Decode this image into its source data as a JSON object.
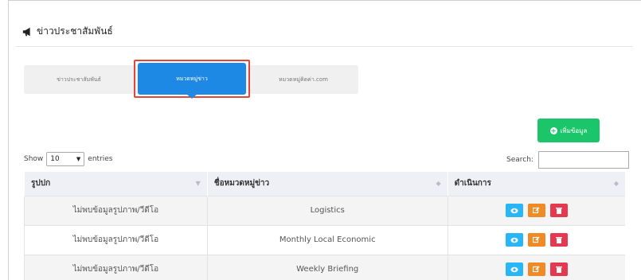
{
  "header": {
    "title": "ข่าวประชาสัมพันธ์",
    "icon": "megaphone-icon"
  },
  "tabs": [
    {
      "label": "ข่าวประชาสัมพันธ์",
      "active": false
    },
    {
      "label": "หมวดหมู่ข่าว",
      "active": true
    },
    {
      "label": "หมวดหมู่คิดค่า.com",
      "active": false
    }
  ],
  "toolbar": {
    "add_label": "เพิ่มข้อมูล"
  },
  "length": {
    "show": "Show",
    "value": "10",
    "entries": "entries"
  },
  "search": {
    "label": "Search:",
    "value": ""
  },
  "table": {
    "headers": [
      "รูปปก",
      "ชื่อหมวดหมู่ข่าว",
      "ดำเนินการ"
    ],
    "rows": [
      {
        "cover": "ไม่พบข้อมูลรูปภาพ/วีดีโอ",
        "name": "Logistics"
      },
      {
        "cover": "ไม่พบข้อมูลรูปภาพ/วีดีโอ",
        "name": "Monthly Local Economic"
      },
      {
        "cover": "ไม่พบข้อมูลรูปภาพ/วีดีโอ",
        "name": "Weekly Briefing"
      }
    ]
  },
  "colors": {
    "primary": "#1e88e5",
    "success": "#1bc56a",
    "info": "#29b6f6",
    "warning": "#f08a24",
    "danger": "#e53950",
    "highlight": "#e0463c"
  }
}
